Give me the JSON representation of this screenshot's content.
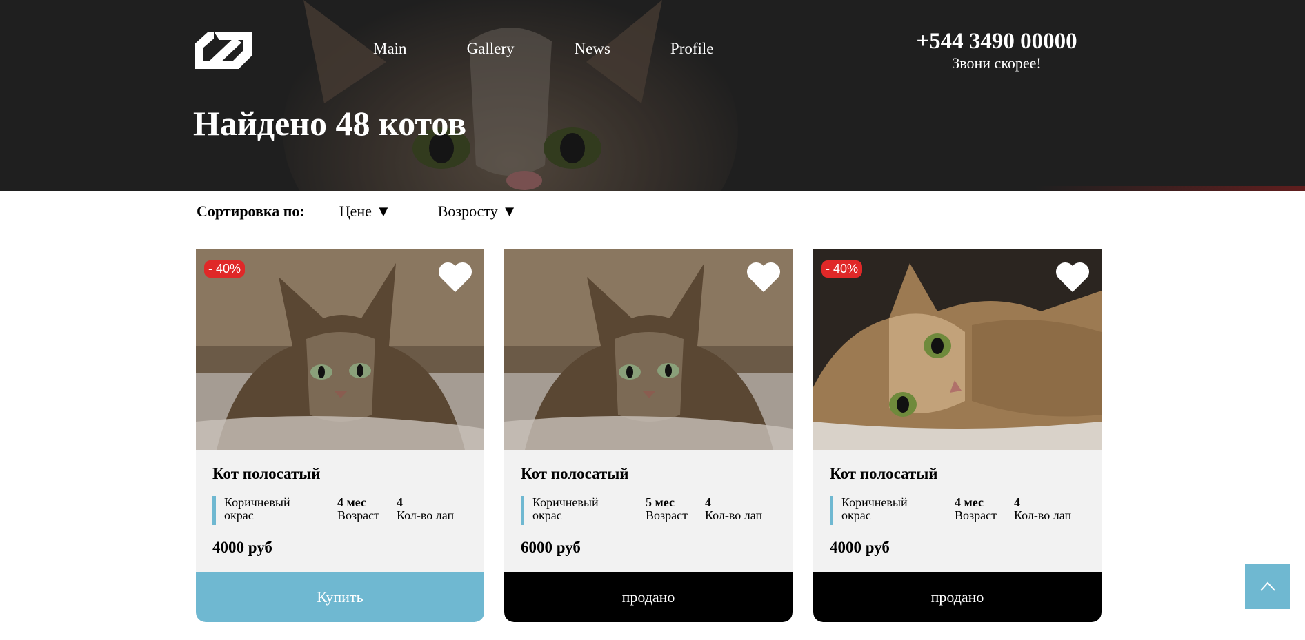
{
  "header": {
    "nav": [
      {
        "label": "Main"
      },
      {
        "label": "Gallery"
      },
      {
        "label": "News"
      },
      {
        "label": "Profile"
      }
    ],
    "phone": "+544 3490 00000",
    "phone_sub": "Звони скорее!",
    "title": "Найдено 48 котов"
  },
  "sort": {
    "label": "Сортировка по:",
    "options": [
      {
        "label": "Цене",
        "arrow": "▼"
      },
      {
        "label": "Возросту",
        "arrow": "▼"
      }
    ]
  },
  "cards": [
    {
      "discount": "- 40%",
      "title": "Кот полосатый",
      "color_line1": "Коричневый",
      "color_line2": "окрас",
      "age_value": "4 мес",
      "age_label": "Возраст",
      "paws_value": "4",
      "paws_label": "Кол-во лап",
      "price": "4000 руб",
      "button": "Купить"
    },
    {
      "title": "Кот полосатый",
      "color_line1": "Коричневый",
      "color_line2": "окрас",
      "age_value": "5 мес",
      "age_label": "Возраст",
      "paws_value": "4",
      "paws_label": "Кол-во лап",
      "price": "6000 руб",
      "button": "продано"
    },
    {
      "discount": "- 40%",
      "title": "Кот полосатый",
      "color_line1": "Коричневый",
      "color_line2": "окрас",
      "age_value": "4 мес",
      "age_label": "Возраст",
      "paws_value": "4",
      "paws_label": "Кол-во лап",
      "price": "4000 руб",
      "button": "продано"
    }
  ],
  "colors": {
    "accent": "#6fb8d1",
    "discount": "#e02828",
    "hero_bg": "#1f1f1f",
    "card_bg": "#f2f2f2"
  },
  "icons": {
    "logo": "brand-logo",
    "favorite": "heart-icon",
    "scroll_top": "chevron-up-icon"
  }
}
